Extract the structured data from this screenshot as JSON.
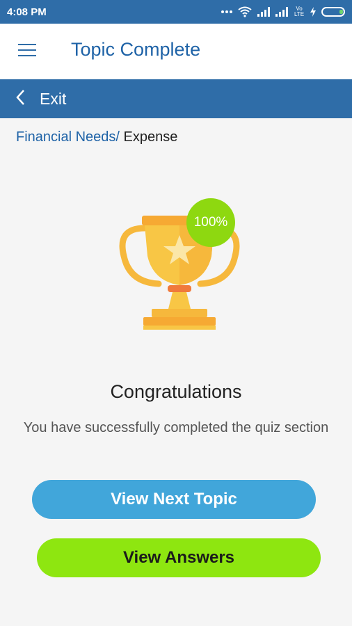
{
  "status_bar": {
    "time": "4:08 PM",
    "icons": [
      "more-icon",
      "wifi-icon",
      "signal-icon",
      "signal-icon",
      "volte-icon",
      "charging-icon",
      "battery-icon"
    ],
    "volte_label": "Vo LTE"
  },
  "app_bar": {
    "title": "Topic Complete",
    "menu_icon": "hamburger-icon"
  },
  "sub_bar": {
    "back_icon": "chevron-left-icon",
    "exit_label": "Exit"
  },
  "breadcrumb": {
    "parent": "Financial Needs/",
    "current": " Expense"
  },
  "result": {
    "percent": "100%",
    "heading": "Congratulations",
    "message": "You have successfully completed the quiz section"
  },
  "buttons": {
    "next_label": "View Next Topic",
    "answers_label": "View Answers"
  },
  "colors": {
    "primary": "#2f6da8",
    "next_button": "#41a6da",
    "answers_button": "#8ee610",
    "badge": "#8ed810",
    "trophy_gold": "#f6c043"
  }
}
